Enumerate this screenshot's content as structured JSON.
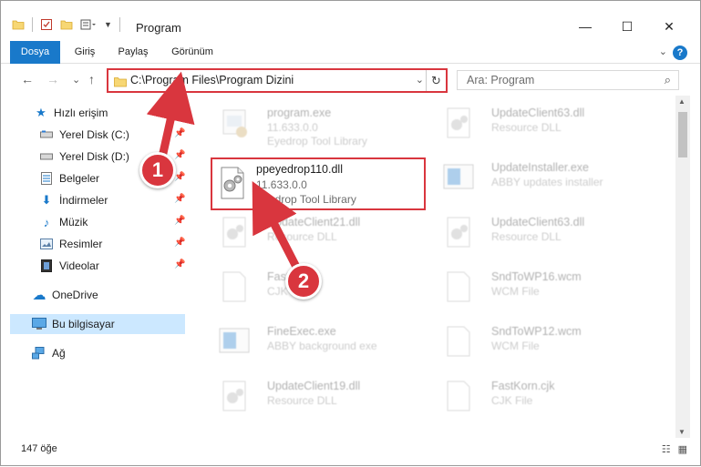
{
  "window": {
    "title": "Program",
    "controls": {
      "minimize": "—",
      "maximize": "☐",
      "close": "✕"
    }
  },
  "ribbon": {
    "tabs": [
      {
        "label": "Dosya",
        "active": true
      },
      {
        "label": "Giriş",
        "active": false
      },
      {
        "label": "Paylaş",
        "active": false
      },
      {
        "label": "Görünüm",
        "active": false
      }
    ],
    "help": "?"
  },
  "nav": {
    "back": "←",
    "forward": "→",
    "recent": "⌄",
    "up": "↑",
    "address": "C:\\Program Files\\Program Dizini",
    "dropdown": "⌄",
    "refresh": "↻",
    "search_placeholder": "Ara: Program",
    "search_icon": "⌕"
  },
  "sidebar": {
    "items": [
      {
        "label": "Hızlı erişim",
        "icon": "star-icon",
        "glyph": "★",
        "pinned": false,
        "selected": false
      },
      {
        "label": "Yerel Disk (C:)",
        "icon": "drive-icon",
        "glyph": "▬",
        "pinned": true,
        "selected": false
      },
      {
        "label": "Yerel Disk (D:)",
        "icon": "drive-icon",
        "glyph": "▬",
        "pinned": true,
        "selected": false
      },
      {
        "label": "Belgeler",
        "icon": "documents-icon",
        "glyph": "▤",
        "pinned": true,
        "selected": false
      },
      {
        "label": "İndirmeler",
        "icon": "download-icon",
        "glyph": "⬇",
        "pinned": true,
        "selected": false
      },
      {
        "label": "Müzik",
        "icon": "music-icon",
        "glyph": "♪",
        "pinned": true,
        "selected": false
      },
      {
        "label": "Resimler",
        "icon": "pictures-icon",
        "glyph": "▭",
        "pinned": true,
        "selected": false
      },
      {
        "label": "Videolar",
        "icon": "videos-icon",
        "glyph": "▦",
        "pinned": true,
        "selected": false
      },
      {
        "label": "OneDrive",
        "icon": "cloud-icon",
        "glyph": "☁",
        "pinned": false,
        "selected": false
      },
      {
        "label": "Bu bilgisayar",
        "icon": "computer-icon",
        "glyph": "▭",
        "pinned": false,
        "selected": true
      },
      {
        "label": "Ağ",
        "icon": "network-icon",
        "glyph": "⊞",
        "pinned": false,
        "selected": false
      }
    ]
  },
  "files": [
    {
      "name": "program.exe",
      "line2": "11.633.0.0",
      "line3": "Eyedrop Tool Library",
      "kind": "exe",
      "faded": true,
      "focused": false
    },
    {
      "name": "UpdateClient63.dll",
      "line2": "Resource DLL",
      "line3": "",
      "kind": "dll",
      "faded": true,
      "focused": false
    },
    {
      "name": "ppeyedrop110.dll",
      "line2": "11.633.0.0",
      "line3": "Eyedrop Tool Library",
      "kind": "gear",
      "faded": false,
      "focused": true
    },
    {
      "name": "UpdateInstaller.exe",
      "line2": "ABBY updates installer",
      "line3": "",
      "kind": "app",
      "faded": true,
      "focused": false
    },
    {
      "name": "UpdateClient21.dll",
      "line2": "Resource DLL",
      "line3": "",
      "kind": "gear",
      "faded": true,
      "focused": false
    },
    {
      "name": "UpdateClient63.dll",
      "line2": "Resource DLL",
      "line3": "",
      "kind": "gear",
      "faded": true,
      "focused": false
    },
    {
      "name": "FastK...",
      "line2": "CJK F...",
      "line3": "",
      "kind": "blank",
      "faded": true,
      "focused": false
    },
    {
      "name": "SndToWP16.wcm",
      "line2": "WCM File",
      "line3": "",
      "kind": "blank",
      "faded": true,
      "focused": false
    },
    {
      "name": "FineExec.exe",
      "line2": "ABBY background exe",
      "line3": "",
      "kind": "app",
      "faded": true,
      "focused": false
    },
    {
      "name": "SndToWP12.wcm",
      "line2": "WCM File",
      "line3": "",
      "kind": "blank",
      "faded": true,
      "focused": false
    },
    {
      "name": "UpdateClient19.dll",
      "line2": "Resource DLL",
      "line3": "",
      "kind": "gear",
      "faded": true,
      "focused": false
    },
    {
      "name": "FastKorn.cjk",
      "line2": "CJK File",
      "line3": "",
      "kind": "blank",
      "faded": true,
      "focused": false
    }
  ],
  "status": {
    "count": "147 öğe",
    "details_view": "☷",
    "tiles_view": "▦"
  },
  "annotations": [
    {
      "label": "1",
      "color": "#d9363e"
    },
    {
      "label": "2",
      "color": "#d9363e"
    }
  ],
  "colors": {
    "accent": "#1979ca",
    "highlight": "#d9363e",
    "selection": "#cce8ff"
  }
}
